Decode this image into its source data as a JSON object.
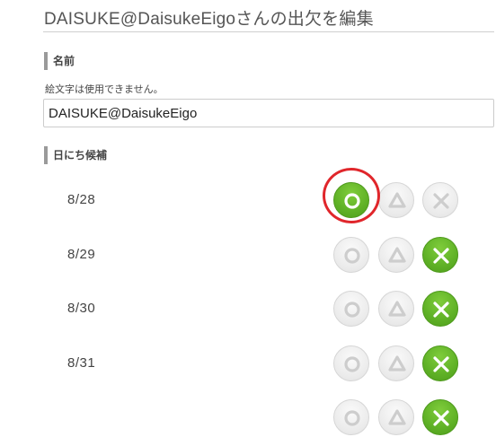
{
  "page": {
    "title": "DAISUKE@DaisukeEigoさんの出欠を編集"
  },
  "name_section": {
    "heading": "名前",
    "note": "絵文字は使用できません。",
    "value": "DAISUKE@DaisukeEigo"
  },
  "dates_section": {
    "heading": "日にち候補",
    "rows": [
      {
        "date": "8/28",
        "selected": "circle"
      },
      {
        "date": "8/29",
        "selected": "cross"
      },
      {
        "date": "8/30",
        "selected": "cross"
      },
      {
        "date": "8/31",
        "selected": "cross"
      },
      {
        "date": "",
        "selected": "cross"
      }
    ]
  },
  "options": {
    "circle": "circle-icon",
    "triangle": "triangle-icon",
    "cross": "cross-icon"
  },
  "colors": {
    "selected_green": "#5fb126",
    "unselected_gray": "#eaeaea",
    "annotation_red": "#e0262b"
  }
}
